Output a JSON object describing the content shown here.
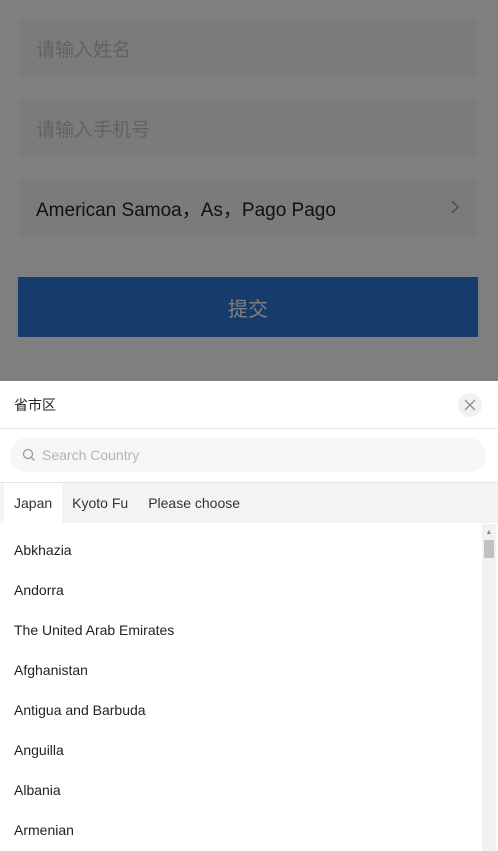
{
  "form": {
    "name_placeholder": "请输入姓名",
    "phone_placeholder": "请输入手机号",
    "region_value": "American Samoa，As，Pago Pago",
    "submit_label": "提交"
  },
  "sheet": {
    "title": "省市区",
    "close_icon": "×",
    "search_placeholder": "Search Country",
    "tabs": [
      "Japan",
      "Kyoto Fu",
      "Please choose"
    ],
    "active_tab": "Japan",
    "items": [
      "Abkhazia",
      "Andorra",
      "The United Arab Emirates",
      "Afghanistan",
      "Antigua and Barbuda",
      "Anguilla",
      "Albania",
      "Armenian"
    ]
  },
  "colors": {
    "primary": "#2f76d4",
    "mask": "rgba(0,0,0,0.5)",
    "tab_bar": "#f2f3f5"
  }
}
